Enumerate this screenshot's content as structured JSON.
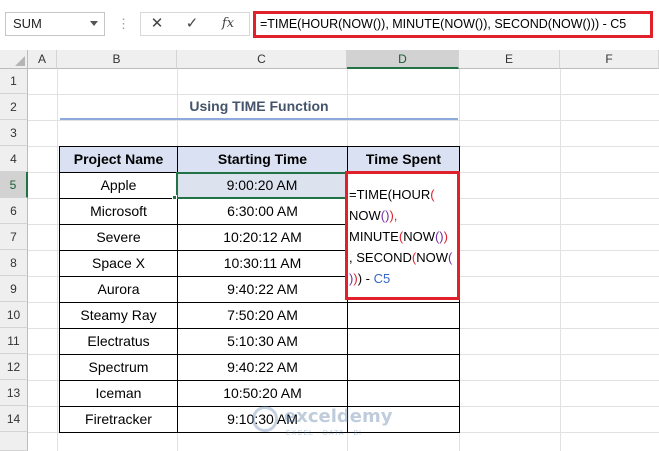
{
  "formula_bar": {
    "name_box": "SUM",
    "separator": "⋮",
    "cancel_icon": "✕",
    "enter_icon": "✓",
    "fx_label": "fx",
    "formula": "=TIME(HOUR(NOW()), MINUTE(NOW()), SECOND(NOW())) - C5"
  },
  "columns": [
    "A",
    "B",
    "C",
    "D",
    "E",
    "F"
  ],
  "rows": [
    "1",
    "2",
    "3",
    "4",
    "5",
    "6",
    "7",
    "8",
    "9",
    "10",
    "11",
    "12",
    "13",
    "14"
  ],
  "sheet": {
    "title": "Using TIME Function",
    "headers": [
      "Project Name",
      "Starting Time",
      "Time Spent"
    ],
    "data": [
      [
        "Apple",
        "9:00:20 AM"
      ],
      [
        "Microsoft",
        "6:30:00 AM"
      ],
      [
        "Severe",
        "10:20:12 AM"
      ],
      [
        "Space X",
        "10:30:11 AM"
      ],
      [
        "Aurora",
        "9:40:22 AM"
      ],
      [
        "Steamy Ray",
        "7:50:20 AM"
      ],
      [
        "Electratus",
        "5:10:30 AM"
      ],
      [
        "Spectrum",
        "9:40:22 AM"
      ],
      [
        "Iceman",
        "10:50:20 AM"
      ],
      [
        "Firetracker",
        "9:10:30 AM"
      ]
    ],
    "editing_formula": {
      "l1a": "=TIME(HOUR",
      "l1b": "(",
      "l2a": "NOW",
      "l2b": "()",
      "l2c": "),",
      "l3a": "MINUTE",
      "l3b": "(",
      "l3c": "NOW",
      "l3d": "()",
      "l3e": ")",
      "l4a": ", SECOND",
      "l4b": "(",
      "l4c": "NOW",
      "l4d": "(",
      "l5a": ")",
      "l5b": ")",
      "l5c": ")",
      "l5d": " - ",
      "l5e": "C5"
    }
  },
  "watermark": {
    "name": "exceldemy",
    "tagline": "EXCEL · DATA · BI"
  },
  "colors": {
    "accent_green": "#217346",
    "highlight_red": "#e0202a",
    "header_fill": "#d9e1f2",
    "title_text": "#44546a"
  }
}
